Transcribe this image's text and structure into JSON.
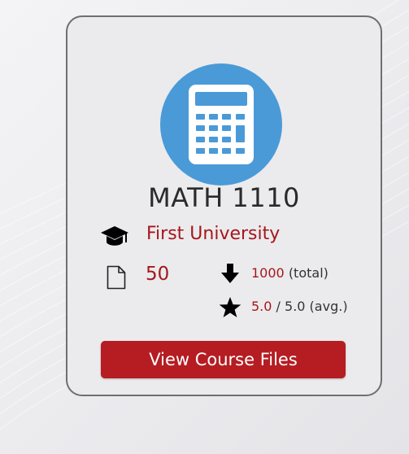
{
  "card": {
    "icon": "calculator-icon",
    "course_code": "MATH 1110",
    "university": {
      "icon": "graduation-cap-icon",
      "name": "First University"
    },
    "files": {
      "icon": "document-icon",
      "count": "50"
    },
    "downloads": {
      "icon": "download-arrow-icon",
      "value": "1000",
      "suffix": "(total)"
    },
    "rating": {
      "icon": "star-icon",
      "value": "5.0",
      "suffix": "/ 5.0 (avg.)"
    },
    "button_label": "View Course Files"
  },
  "colors": {
    "accent_red": "#b51d22",
    "text_red": "#a5171b",
    "icon_blue": "#4a9ad8",
    "border": "#6f6f6f"
  }
}
